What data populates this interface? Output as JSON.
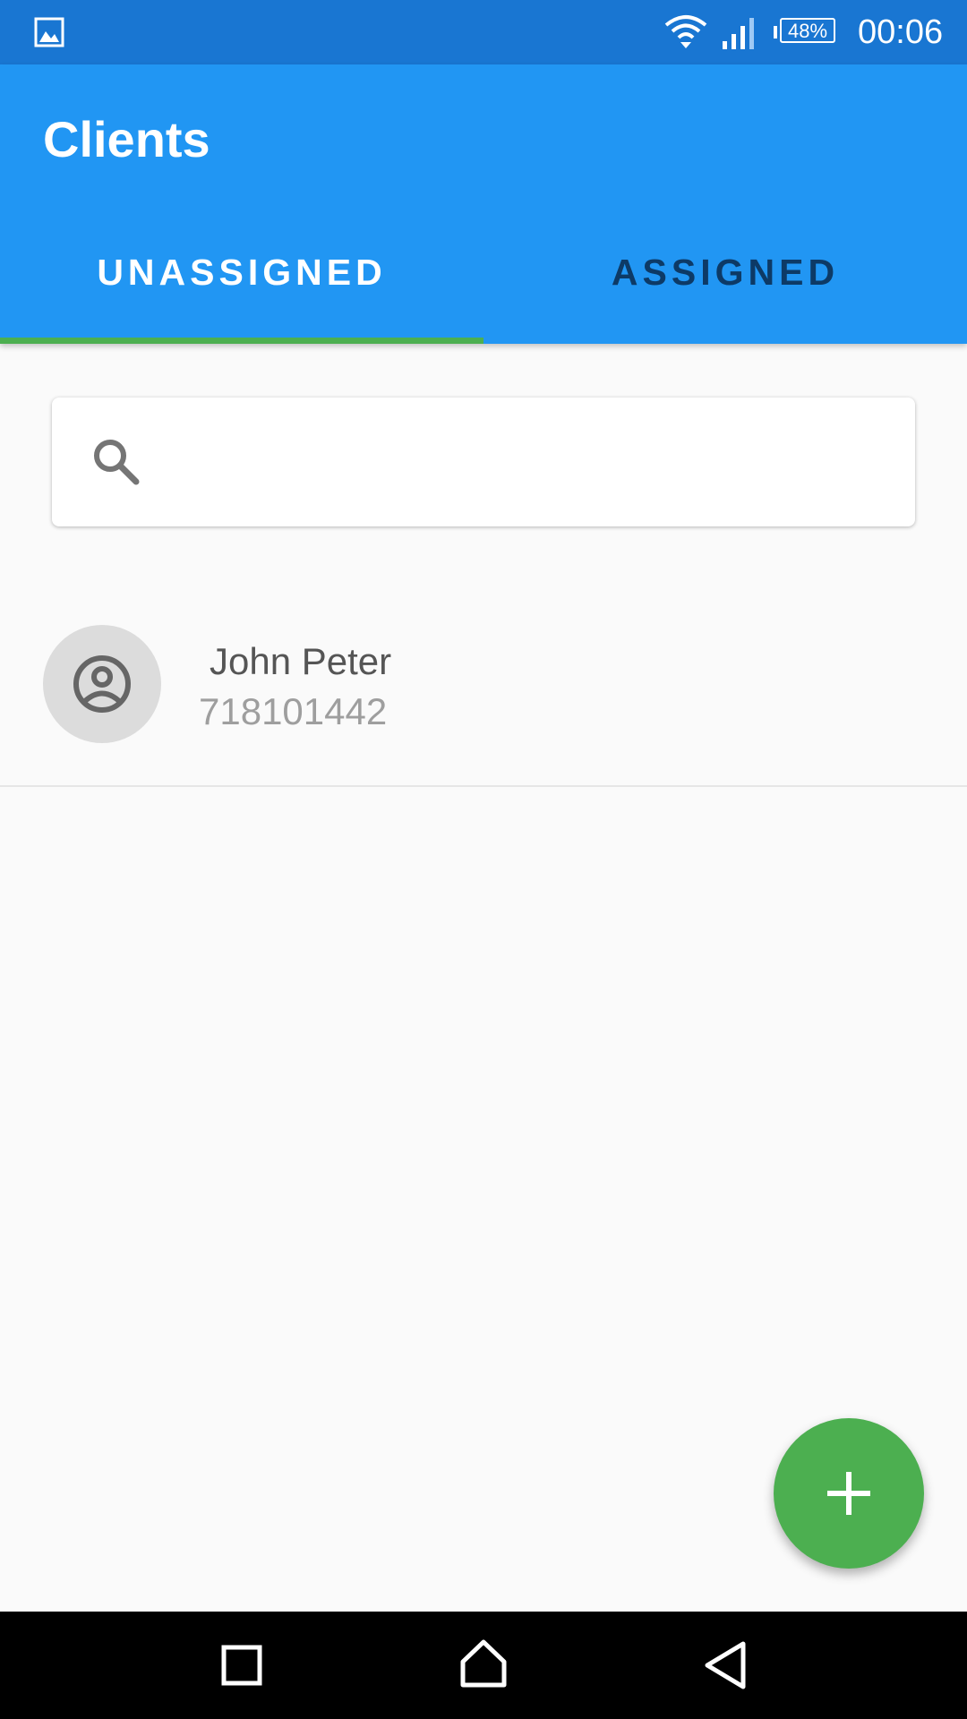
{
  "status_bar": {
    "battery": "48%",
    "time": "00:06",
    "icons": [
      "gallery-icon",
      "wifi-icon",
      "signal-icon",
      "battery-icon"
    ]
  },
  "app_bar": {
    "title": "Clients",
    "tabs": [
      {
        "label": "UNASSIGNED",
        "selected": true
      },
      {
        "label": "ASSIGNED",
        "selected": false
      }
    ]
  },
  "search": {
    "value": "",
    "placeholder": "",
    "icon": "search-icon"
  },
  "clients": [
    {
      "name": "John Peter",
      "phone": "718101442",
      "avatar_icon": "account-circle-icon"
    }
  ],
  "fab": {
    "icon": "plus-icon"
  },
  "nav_bar": {
    "icons": [
      "recent-apps-icon",
      "home-icon",
      "back-icon"
    ]
  },
  "colors": {
    "status_bar": "#1976d2",
    "app_bar": "#2196f3",
    "tab_indicator": "#4caf50",
    "fab": "#4caf50",
    "background": "#fafafa",
    "inactive_tab": "#0d3a66"
  }
}
